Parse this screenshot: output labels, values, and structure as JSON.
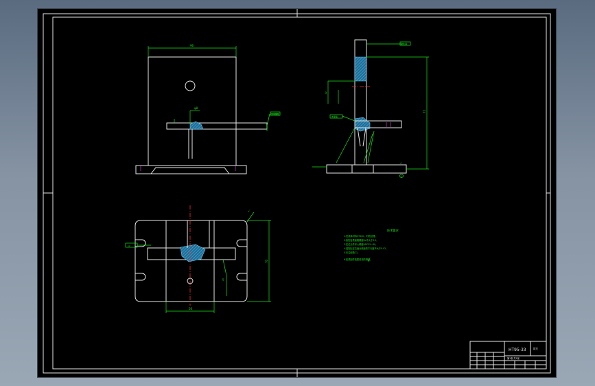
{
  "title_block": {
    "drawing_no": "HT95-33",
    "part_name": "拨叉",
    "sheet_info": "第1张 共1张"
  },
  "notes": {
    "heading": "技术要求",
    "lines": [
      "1.夹具体材料HT200，时效处理。",
      "2.各配合表面粗糙度Ra不大于3.2。",
      "3.定位元件淬火硬度HRC55~60。",
      "4.装配后定位面对底面的平行度不大于0.02。",
      "5.未注倒角C1。",
      "6.各紧固件装配前涂防锈油。"
    ]
  },
  "dims": {
    "front_width": "96",
    "front_tol": "φ8",
    "side_height": "72",
    "side_note": "62",
    "plan_height": "70",
    "plan_width": "56",
    "plan_slot": "12",
    "plan_hole": "20"
  },
  "tags": {
    "front": "夹紧螺栓",
    "side_top": "定位销",
    "side_left": "支承板",
    "balloon": "1"
  },
  "colors": {
    "outline": "#e8e8e8",
    "dimension": "#19e619",
    "center_line": "#ff2a2a",
    "hatch": "#4aa8d8"
  }
}
